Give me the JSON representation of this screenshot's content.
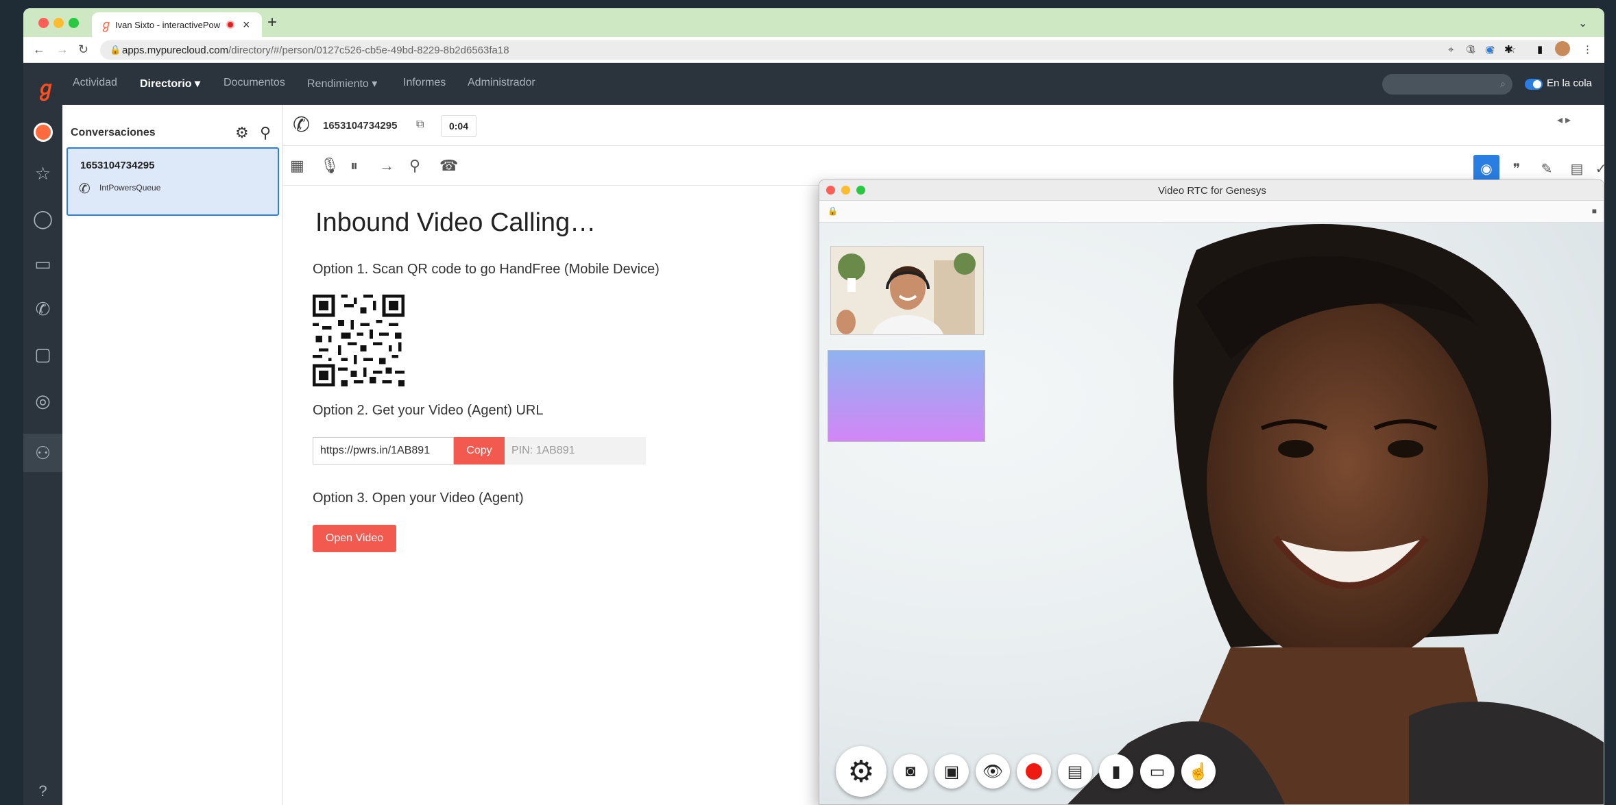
{
  "browser": {
    "tab_title": "Ivan Sixto - interactivePow",
    "new_tab": "+",
    "url_host": "apps.mypurecloud.com",
    "url_path": "/directory/#/person/0127c526-cb5e-49bd-8229-8b2d6563fa18"
  },
  "appnav": {
    "items": [
      "Actividad",
      "Directorio",
      "Documentos",
      "Rendimiento",
      "Informes",
      "Administrador"
    ],
    "search_placeholder": "",
    "queue_label": "En la cola"
  },
  "conversations": {
    "title": "Conversaciones",
    "card": {
      "number": "1653104734295",
      "queue": "IntPowersQueue"
    }
  },
  "call": {
    "number": "1653104734295",
    "timer": "0:04"
  },
  "script": {
    "title": "Inbound Video Calling…",
    "option1": "Option 1. Scan QR code to go HandFree (Mobile Device)",
    "option2": "Option 2. Get your Video (Agent) URL",
    "url_value": "https://pwrs.in/1AB891",
    "copy_label": "Copy",
    "pin": "PIN: 1AB891",
    "option3": "Option 3. Open your Video (Agent)",
    "open_video_label": "Open Video"
  },
  "video_window": {
    "title": "Video RTC for Genesys",
    "controls": [
      "settings-icon",
      "agent-camera-icon",
      "webcam-icon",
      "eye-icon",
      "record-icon",
      "chat-icon",
      "file-icon",
      "screen-share-icon",
      "pointer-icon"
    ]
  },
  "colors": {
    "accent": "#f25a4f",
    "selection_blue": "#2a7de1",
    "brand_orange": "#ff4f1f",
    "nav_bg": "#2b343c"
  }
}
